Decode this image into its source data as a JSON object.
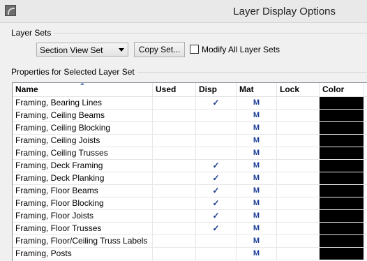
{
  "window": {
    "title": "Layer Display Options"
  },
  "layer_sets": {
    "label": "Layer Sets",
    "selected": "Section View Set",
    "copy_button": "Copy Set...",
    "modify_all_label": "Modify All Layer Sets",
    "modify_all_checked": false
  },
  "properties": {
    "label": "Properties for Selected Layer Set",
    "columns": [
      "Name",
      "Used",
      "Disp",
      "Mat",
      "Lock",
      "Color"
    ],
    "rows": [
      {
        "name": "Framing, Bearing Lines",
        "used": "",
        "disp": "✓",
        "mat": "M",
        "lock": "",
        "color": "#000000"
      },
      {
        "name": "Framing, Ceiling Beams",
        "used": "",
        "disp": "",
        "mat": "M",
        "lock": "",
        "color": "#000000"
      },
      {
        "name": "Framing, Ceiling Blocking",
        "used": "",
        "disp": "",
        "mat": "M",
        "lock": "",
        "color": "#000000"
      },
      {
        "name": "Framing, Ceiling Joists",
        "used": "",
        "disp": "",
        "mat": "M",
        "lock": "",
        "color": "#000000"
      },
      {
        "name": "Framing, Ceiling Trusses",
        "used": "",
        "disp": "",
        "mat": "M",
        "lock": "",
        "color": "#000000"
      },
      {
        "name": "Framing, Deck Framing",
        "used": "",
        "disp": "✓",
        "mat": "M",
        "lock": "",
        "color": "#000000"
      },
      {
        "name": "Framing, Deck Planking",
        "used": "",
        "disp": "✓",
        "mat": "M",
        "lock": "",
        "color": "#000000"
      },
      {
        "name": "Framing, Floor Beams",
        "used": "",
        "disp": "✓",
        "mat": "M",
        "lock": "",
        "color": "#000000"
      },
      {
        "name": "Framing, Floor Blocking",
        "used": "",
        "disp": "✓",
        "mat": "M",
        "lock": "",
        "color": "#000000"
      },
      {
        "name": "Framing, Floor Joists",
        "used": "",
        "disp": "✓",
        "mat": "M",
        "lock": "",
        "color": "#000000"
      },
      {
        "name": "Framing, Floor Trusses",
        "used": "",
        "disp": "✓",
        "mat": "M",
        "lock": "",
        "color": "#000000"
      },
      {
        "name": "Framing, Floor/Ceiling Truss Labels",
        "used": "",
        "disp": "",
        "mat": "M",
        "lock": "",
        "color": "#000000"
      },
      {
        "name": "Framing, Posts",
        "used": "",
        "disp": "",
        "mat": "M",
        "lock": "",
        "color": "#000000"
      }
    ]
  }
}
